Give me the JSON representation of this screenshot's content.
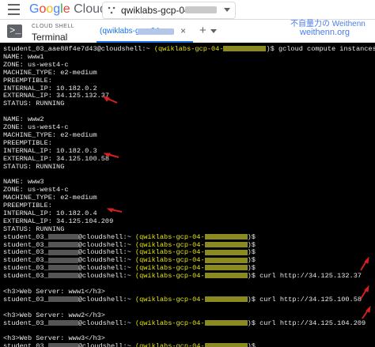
{
  "topbar": {
    "brand": "Google Cloud",
    "project": "qwiklabs-gcp-04-"
  },
  "shellbar": {
    "small_label": "CLOUD SHELL",
    "big_label": "Terminal",
    "tab_label": "(qwiklabs-gcp-04-",
    "tab_close": "×",
    "add_tab": "+"
  },
  "watermark": {
    "line1": "不自量力の Weithenn",
    "line2": "weithenn.org"
  },
  "terminal": {
    "prompt_user": "student_03_aae88f4e7d43@cloudshell:~ ",
    "project_prefix": "(qwiklabs-gcp-04-",
    "lines": [
      {
        "user": "student_03_aae88f4e7d43@cloudshell:~ ",
        "proj": "(qwiklabs-gcp-04-",
        "cmd": ")$ gcloud compute instances list"
      },
      {
        "text": "NAME: www1"
      },
      {
        "text": "ZONE: us-west4-c"
      },
      {
        "text": "MACHINE_TYPE: e2-medium"
      },
      {
        "text": "PREEMPTIBLE:"
      },
      {
        "text": "INTERNAL_IP: 10.182.0.2"
      },
      {
        "text": "EXTERNAL_IP: 34.125.132.37"
      },
      {
        "text": "STATUS: RUNNING"
      },
      {
        "text": ""
      },
      {
        "text": "NAME: www2"
      },
      {
        "text": "ZONE: us-west4-c"
      },
      {
        "text": "MACHINE_TYPE: e2-medium"
      },
      {
        "text": "PREEMPTIBLE:"
      },
      {
        "text": "INTERNAL_IP: 10.182.0.3"
      },
      {
        "text": "EXTERNAL_IP: 34.125.100.58"
      },
      {
        "text": "STATUS: RUNNING"
      },
      {
        "text": ""
      },
      {
        "text": "NAME: www3"
      },
      {
        "text": "ZONE: us-west4-c"
      },
      {
        "text": "MACHINE_TYPE: e2-medium"
      },
      {
        "text": "PREEMPTIBLE:"
      },
      {
        "text": "INTERNAL_IP: 10.182.0.4"
      },
      {
        "text": "EXTERNAL_IP: 34.125.104.209"
      },
      {
        "text": "STATUS: RUNNING"
      },
      {
        "user": "student_03_",
        "proj": "(qwiklabs-gcp-04-",
        "cmd": ")$",
        "masked": true
      },
      {
        "user": "student_03_",
        "proj": "(qwiklabs-gcp-04-",
        "cmd": ")$",
        "masked": true
      },
      {
        "user": "student_03_",
        "proj": "(qwiklabs-gcp-04-",
        "cmd": ")$",
        "masked": true
      },
      {
        "user": "student_03_",
        "proj": "(qwiklabs-gcp-04-",
        "cmd": ")$",
        "masked": true
      },
      {
        "user": "student_03_",
        "proj": "(qwiklabs-gcp-04-",
        "cmd": ")$",
        "masked": true
      },
      {
        "user": "student_03_",
        "proj": "(qwiklabs-gcp-04-",
        "cmd": ")$ curl http://34.125.132.37",
        "masked": true
      },
      {
        "text": ""
      },
      {
        "text": "<h3>Web Server: www1</h3>"
      },
      {
        "user": "student_03_",
        "proj": "(qwiklabs-gcp-04-",
        "cmd": ")$ curl http://34.125.100.58",
        "masked": true
      },
      {
        "text": ""
      },
      {
        "text": "<h3>Web Server: www2</h3>"
      },
      {
        "user": "student_03_",
        "proj": "(qwiklabs-gcp-04-",
        "cmd": ")$ curl http://34.125.104.209",
        "masked": true
      },
      {
        "text": ""
      },
      {
        "text": "<h3>Web Server: www3</h3>"
      },
      {
        "user": "student_03_",
        "proj": "(qwiklabs-gcp-04-",
        "cmd": ")$",
        "masked": true
      }
    ]
  },
  "colors": {
    "prompt_yellow": "#e5e510",
    "arrow_red": "#d42020",
    "link_blue": "#1a73e8"
  }
}
